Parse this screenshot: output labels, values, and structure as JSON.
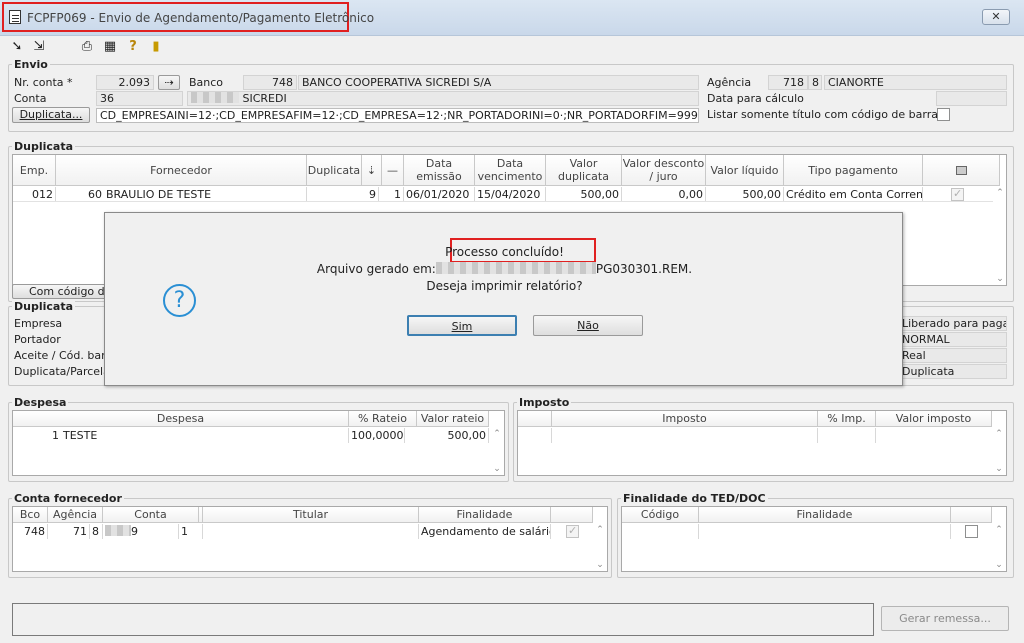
{
  "window": {
    "title": "FCPFP069 - Envio de Agendamento/Pagamento Eletrônico",
    "close": "✕"
  },
  "toolbar": {
    "icons": [
      "arrow-icon",
      "multi-arrow-icon",
      "printer-icon",
      "grid-icon",
      "help-icon",
      "exit-door-icon"
    ]
  },
  "envio": {
    "title": "Envio",
    "nr_conta_label": "Nr. conta *",
    "nr_conta_value": "2.093",
    "banco_label": "Banco",
    "banco_code": "748",
    "banco_name": "BANCO COOPERATIVA SICREDI S/A",
    "conta_label": "Conta",
    "conta_value": "36",
    "conta_name": "SICREDI",
    "duplicata_button": "Duplicata...",
    "filter_text": "CD_EMPRESAINI=12·;CD_EMPRESAFIM=12·;CD_EMPRESA=12·;NR_PORTADORINI=0·;NR_PORTADORFIM=9999·;NR_PORTAD",
    "agencia_label": "Agência",
    "agencia_code": "718",
    "agencia_digit": "8",
    "agencia_name": "CIANORTE",
    "data_calculo_label": "Data para cálculo",
    "listar_label": "Listar somente título com código de barras"
  },
  "duplicata_grid": {
    "title": "Duplicata",
    "headers": [
      "Emp.",
      "Fornecedor",
      "Duplicata",
      "",
      "",
      "Data emissão",
      "Data vencimento",
      "Valor duplicata",
      "Valor desconto / juro",
      "Valor líquido",
      "Tipo pagamento",
      ""
    ],
    "row": {
      "emp": "012",
      "fornecedor_code": "60",
      "fornecedor_name": "BRAULIO DE TESTE",
      "duplicata": "9",
      "parcela": "1",
      "data_emissao": "06/01/2020",
      "data_vencimento": "15/04/2020",
      "valor_duplicata": "500,00",
      "valor_desconto": "0,00",
      "valor_liquido": "500,00",
      "tipo_pagamento": "Crédito em Conta Corrente"
    },
    "codigo_button": "Com código de"
  },
  "duplicata_detail": {
    "title": "Duplicata",
    "empresa_label": "Empresa",
    "portador_label": "Portador",
    "aceite_label": "Aceite / Cód. barra",
    "duplicata_parcela_label": "Duplicata/Parcela",
    "right_values": [
      "Liberado para pagame",
      "NORMAL",
      "Real",
      "Duplicata"
    ]
  },
  "despesa": {
    "title": "Despesa",
    "headers": [
      "Despesa",
      "% Rateio",
      "Valor rateio"
    ],
    "row": {
      "code": "1",
      "name": "TESTE",
      "rateio": "100,000000",
      "valor": "500,00"
    }
  },
  "imposto": {
    "title": "Imposto",
    "headers": [
      "",
      "Imposto",
      "% Imp.",
      "Valor imposto"
    ]
  },
  "conta_fornecedor": {
    "title": "Conta fornecedor",
    "headers": [
      "Bco",
      "Agência",
      "Conta",
      "",
      "Titular",
      "Finalidade"
    ],
    "row": {
      "bco": "748",
      "agencia": "71",
      "agencia_digit": "8",
      "conta": "9",
      "conta_digit": "1",
      "finalidade": "Agendamento de salário"
    }
  },
  "finalidade_ted": {
    "title": "Finalidade do TED/DOC",
    "headers": [
      "Código",
      "Finalidade"
    ]
  },
  "footer": {
    "gerar_button": "Gerar remessa..."
  },
  "dialog": {
    "title_line": "Processo concluído!",
    "file_prefix": "Arquivo gerado em:",
    "file_suffix": "PG030301.REM.",
    "question": "Deseja imprimir relatório?",
    "icon": "question-icon",
    "yes_button": "Sim",
    "no_button": "Não"
  },
  "colors": {
    "highlight": "#e02020",
    "dialog_icon": "#2a8fd4",
    "focus_border": "#3c7fb1"
  }
}
